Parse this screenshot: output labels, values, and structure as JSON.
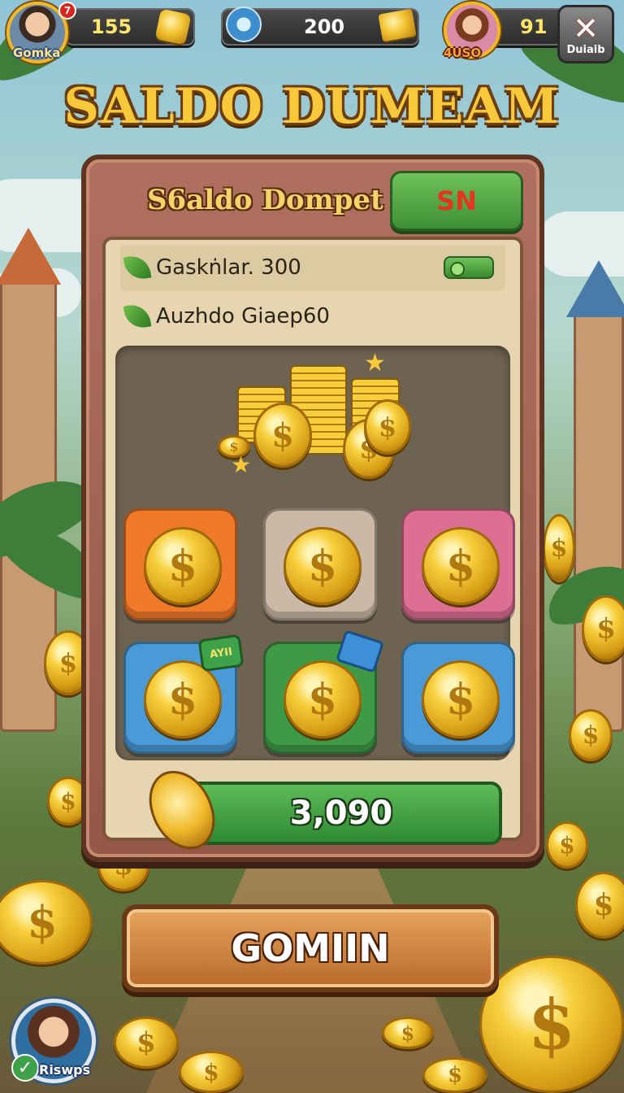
{
  "hud": {
    "left_player": {
      "name": "Gomka",
      "notification_count": "7",
      "value": "155",
      "icon": "gold-nugget-icon"
    },
    "center": {
      "value": "200",
      "left_icon": "compass-icon",
      "right_icon": "gold-bar-icon"
    },
    "right_player": {
      "name": "4USO",
      "value": "91"
    },
    "close_button": {
      "icon": "close-icon",
      "label": "Duiaib"
    }
  },
  "title": "SALDO DUMEAM",
  "panel": {
    "heading": "S6aldo Dompet",
    "sn_button": "SN",
    "rows": [
      {
        "icon": "leaf-icon",
        "text": "Gaskṅlar. 300",
        "toggle_icon": "toggle-icon"
      },
      {
        "icon": "leaf-icon",
        "text": "Auzhdo Giaep60"
      }
    ],
    "coin_tiles": [
      {
        "color": "#f07a2a",
        "icon": "coin-icon",
        "symbol": "$"
      },
      {
        "color": "#cbb8a6",
        "icon": "coin-icon",
        "symbol": "$"
      },
      {
        "color": "#dc6f92",
        "icon": "coin-icon",
        "symbol": "$"
      },
      {
        "color": "#4a9ad8",
        "icon": "coin-icon",
        "symbol": "$",
        "tag": "AYII"
      },
      {
        "color": "#3f9a48",
        "icon": "coin-icon",
        "symbol": "$",
        "tag_icon": "blue-gem-icon"
      },
      {
        "color": "#4a9ad8",
        "icon": "coin-icon",
        "symbol": "$"
      }
    ],
    "total": "3,090",
    "total_icon": "gold-emblem-icon"
  },
  "main_button": "GOMIIN",
  "bottom_profile": {
    "label": "Riswps",
    "check_icon": "check-icon"
  },
  "colors": {
    "accent_gold": "#f7c93a",
    "panel": "#945848",
    "button_green": "#3e8f34",
    "button_orange": "#b86a2c"
  }
}
